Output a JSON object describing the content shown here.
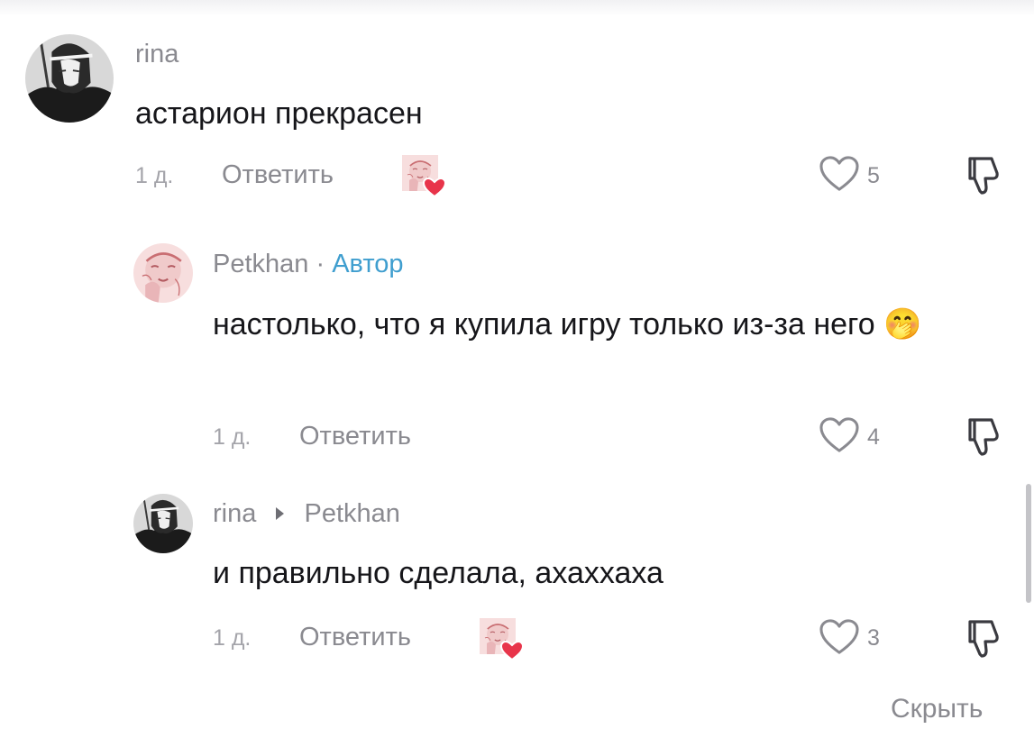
{
  "comments": [
    {
      "username": "rina",
      "text": "астарион прекрасен",
      "time": "1 д.",
      "reply_label": "Ответить",
      "likes": "5",
      "creator_liked": true,
      "avatar_icon": "avatar-dark-anime"
    },
    {
      "username": "Petkhan",
      "separator": "·",
      "author_tag": "Автор",
      "text": "настолько, что я купила игру только из-за него",
      "emoji": "🤭",
      "time": "1 д.",
      "reply_label": "Ответить",
      "likes": "4",
      "creator_liked": false,
      "avatar_icon": "avatar-pink-sketch"
    },
    {
      "username": "rina",
      "reply_to": "Petkhan",
      "text": "и правильно сделала, ахаххаха",
      "time": "1 д.",
      "reply_label": "Ответить",
      "likes": "3",
      "creator_liked": true,
      "avatar_icon": "avatar-dark-anime"
    }
  ],
  "hide_label": "Скрыть",
  "colors": {
    "author_tag": "#3f9ecf",
    "heart_badge": "#e8344a",
    "muted_text": "#8a8a90"
  }
}
